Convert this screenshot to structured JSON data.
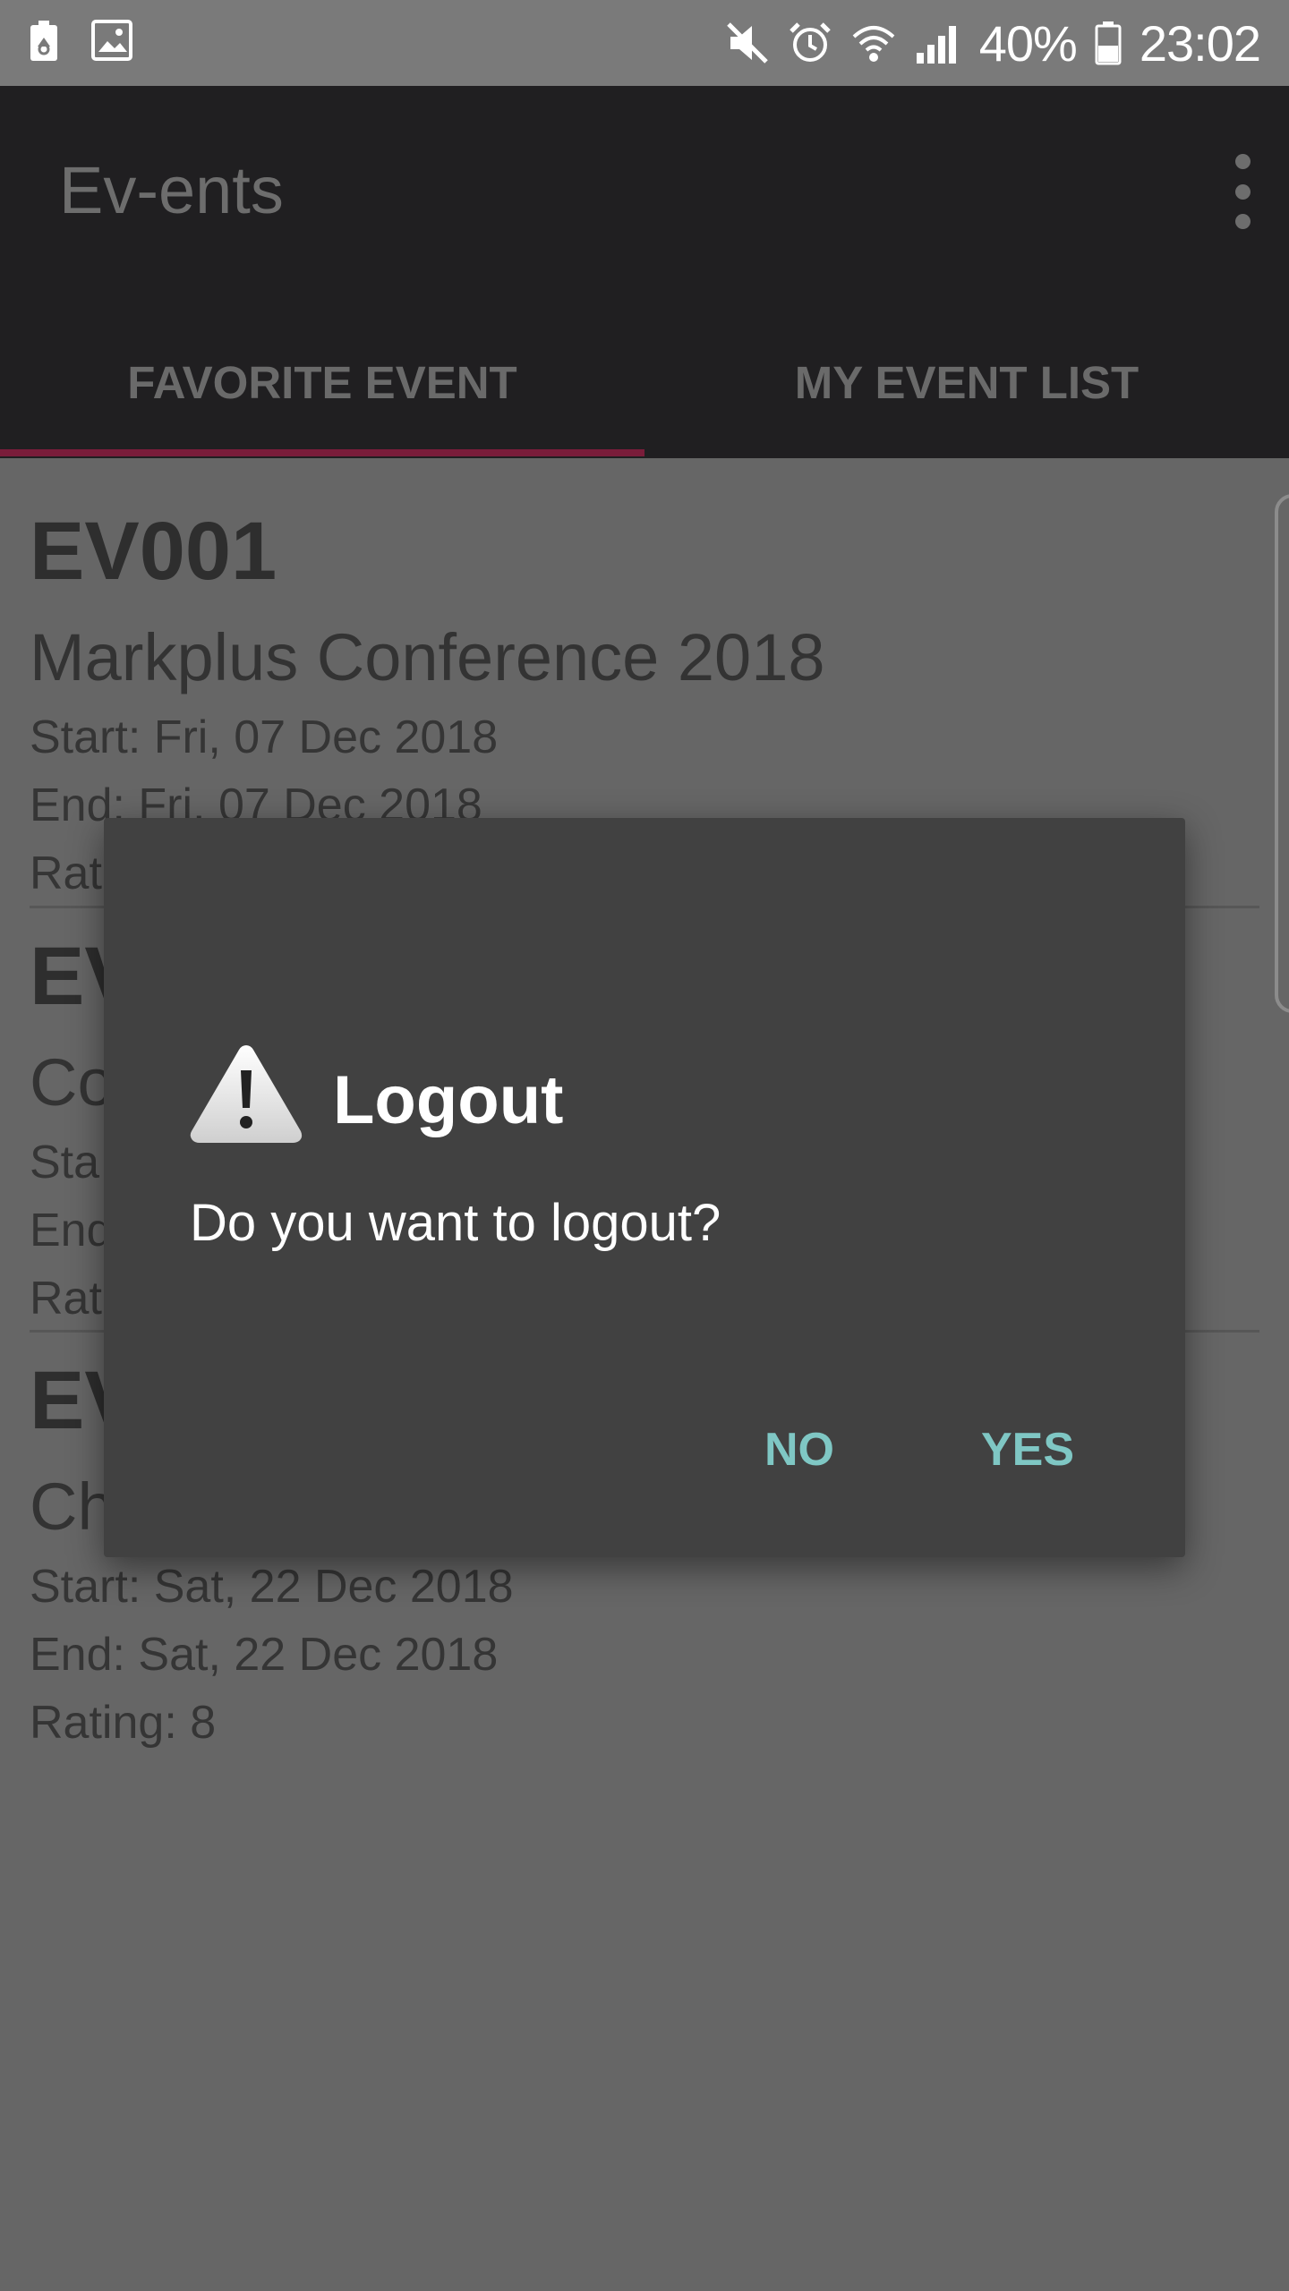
{
  "status_bar": {
    "battery_percent": "40%",
    "time": "23:02",
    "icons": [
      "recycle-battery-icon",
      "image-icon",
      "mute-icon",
      "alarm-icon",
      "wifi-icon",
      "signal-icon",
      "battery-icon"
    ]
  },
  "app_bar": {
    "title": "Ev-ents",
    "tabs": [
      {
        "label": "FAVORITE EVENT",
        "selected": true
      },
      {
        "label": "MY EVENT LIST",
        "selected": false
      }
    ],
    "accent_color": "#7a1d3a"
  },
  "events": [
    {
      "code": "EV001",
      "name": "Markplus Conference 2018",
      "start": "Start: Fri, 07 Dec 2018",
      "end": "End: Fri, 07 Dec 2018",
      "rating": "Rat"
    },
    {
      "code": "EV",
      "name": "Co",
      "start": "Sta",
      "end": "End",
      "rating": "Rat"
    },
    {
      "code": "EV",
      "name": "Ch",
      "start": "Start: Sat, 22 Dec 2018",
      "end": "End: Sat, 22 Dec 2018",
      "rating": "Rating: 8"
    }
  ],
  "dialog": {
    "icon": "warning-icon",
    "title": "Logout",
    "message": "Do you want to logout?",
    "negative_label": "NO",
    "positive_label": "YES",
    "button_color": "#7fc7c4"
  }
}
